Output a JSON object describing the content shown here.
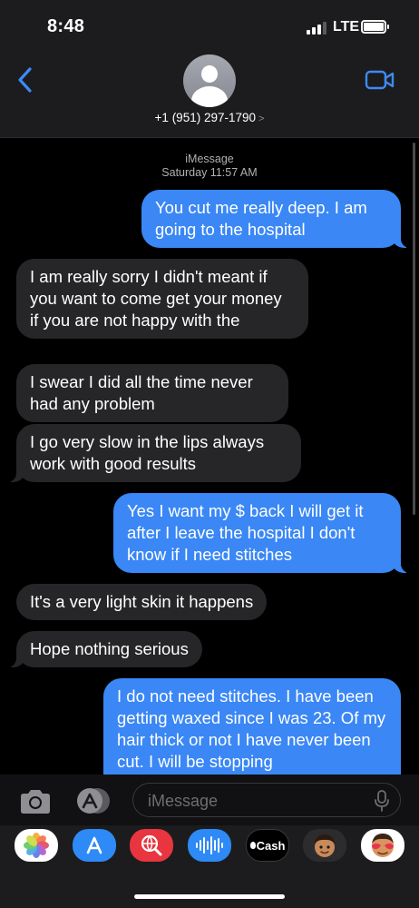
{
  "status_bar": {
    "time": "8:48",
    "network": "LTE",
    "signal_bars_active": 3,
    "signal_bars_total": 4
  },
  "header": {
    "contact": "+1 (951) 297-1790"
  },
  "thread": {
    "service": "iMessage",
    "timestamp": "Saturday 11:57 AM",
    "messages": [
      {
        "direction": "outgoing",
        "text": "You cut me really deep. I am going to the hospital"
      },
      {
        "direction": "incoming",
        "text": "I am really sorry I didn't meant if you want to come get your money if you are not happy with the"
      },
      {
        "direction": "incoming",
        "text": "I swear I did all the time never had any problem"
      },
      {
        "direction": "incoming",
        "text": "I go very slow in the lips always work with good results"
      },
      {
        "direction": "outgoing",
        "text": "Yes I want my $ back I will get it after I leave the hospital I don't know if I need stitches"
      },
      {
        "direction": "incoming",
        "text": "It's a very light skin it happens"
      },
      {
        "direction": "incoming",
        "text": "Hope nothing serious"
      },
      {
        "direction": "outgoing",
        "text": "I do not need stitches. I have been getting waxed since I was 23. Of my hair thick or not I have never been cut. I will be stopping"
      }
    ]
  },
  "input_bar": {
    "placeholder": "iMessage"
  },
  "app_drawer": {
    "apps": [
      {
        "name": "photos-app",
        "icon": "photos-icon"
      },
      {
        "name": "app-store-app",
        "icon": "app-store-icon"
      },
      {
        "name": "images-search-app",
        "icon": "globe-search-icon"
      },
      {
        "name": "audio-message-app",
        "icon": "waveform-icon"
      },
      {
        "name": "apple-cash-app",
        "icon": "apple-cash-icon",
        "label": "Cash"
      },
      {
        "name": "memoji-app",
        "icon": "memoji-icon"
      },
      {
        "name": "memoji-stickers-app",
        "icon": "memoji-stickers-icon"
      }
    ]
  },
  "colors": {
    "outgoing_bubble": "#3a87f5",
    "incoming_bubble": "#262629",
    "accent": "#3b8bf6",
    "background": "#000000"
  }
}
